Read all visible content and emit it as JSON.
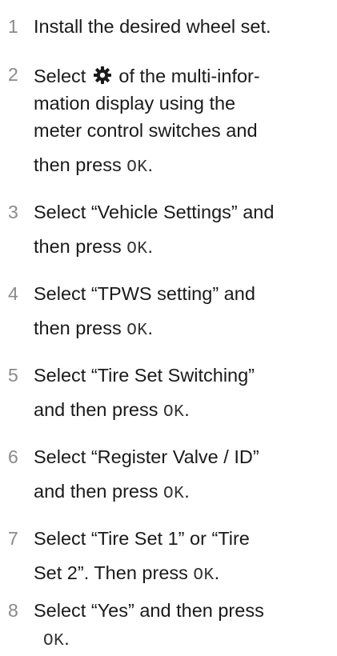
{
  "steps": [
    {
      "number": "1",
      "lines": [
        {
          "text": "Install the desired wheel set."
        }
      ]
    },
    {
      "number": "2",
      "lines": [
        {
          "pre": "Select",
          "icon": "gear-icon",
          "post": "of the multi-infor-"
        },
        {
          "text": "mation display using the"
        },
        {
          "text": "meter control switches and"
        },
        {
          "text": "then press",
          "button": "OK",
          "end": "."
        }
      ]
    },
    {
      "number": "3",
      "lines": [
        {
          "text": "Select “Vehicle Settings” and"
        },
        {
          "text": "then press",
          "button": "OK",
          "end": "."
        }
      ]
    },
    {
      "number": "4",
      "lines": [
        {
          "text": "Select “TPWS setting” and"
        },
        {
          "text": "then press",
          "button": "OK",
          "end": "."
        }
      ]
    },
    {
      "number": "5",
      "lines": [
        {
          "text": "Select “Tire Set Switching”"
        },
        {
          "text": "and then press",
          "button": "OK",
          "end": "."
        }
      ]
    },
    {
      "number": "6",
      "lines": [
        {
          "text": "Select “Register Valve / ID”"
        },
        {
          "text": "and then press",
          "button": "OK",
          "end": "."
        }
      ]
    },
    {
      "number": "7",
      "lines": [
        {
          "text": "Select “Tire Set 1” or “Tire"
        },
        {
          "text": "Set 2”. Then press",
          "button": "OK",
          "end": "."
        }
      ]
    },
    {
      "number": "8",
      "lines": [
        {
          "text": "Select “Yes” and then press"
        },
        {
          "text": "",
          "button": "OK",
          "end": "."
        }
      ]
    }
  ]
}
